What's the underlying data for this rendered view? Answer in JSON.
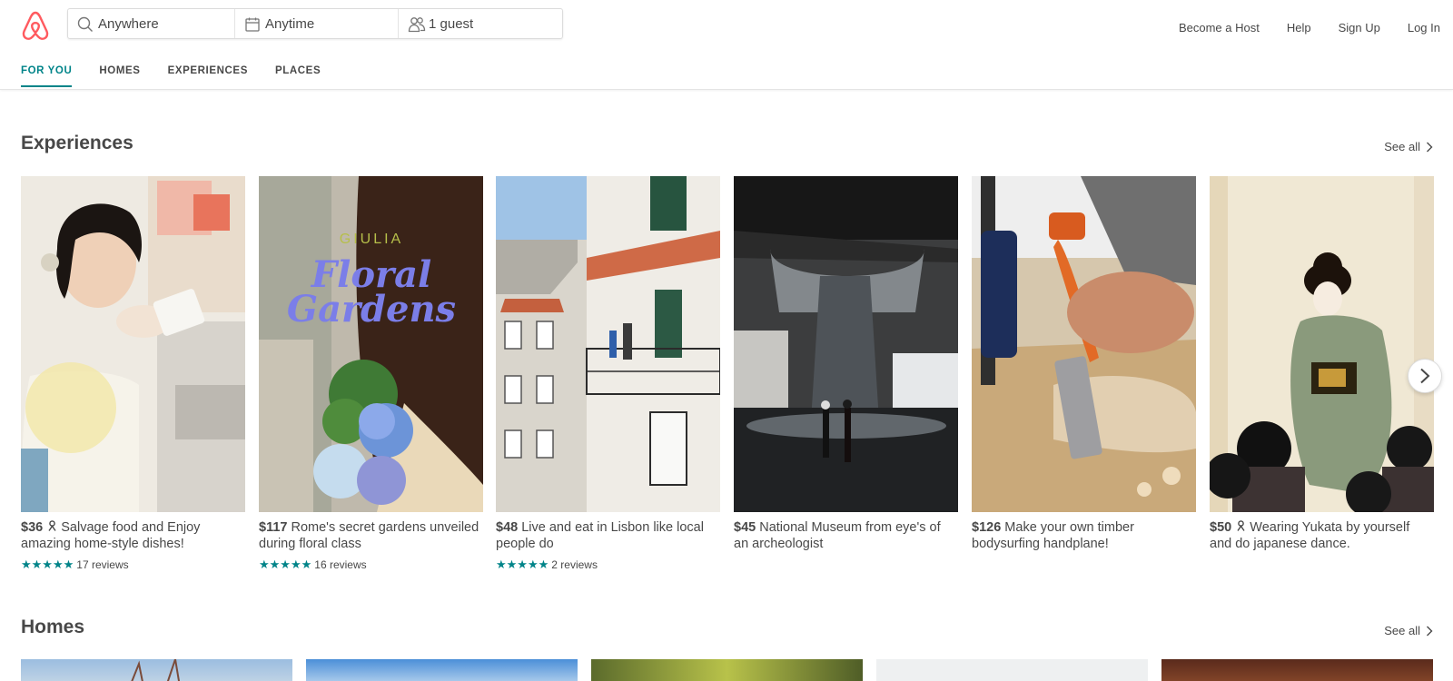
{
  "header": {
    "search": {
      "where_value": "Anywhere",
      "when_value": "Anytime",
      "guests_value": "1 guest"
    },
    "nav": [
      "Become a Host",
      "Help",
      "Sign Up",
      "Log In"
    ],
    "tabs": [
      {
        "label": "FOR YOU",
        "active": true
      },
      {
        "label": "HOMES",
        "active": false
      },
      {
        "label": "EXPERIENCES",
        "active": false
      },
      {
        "label": "PLACES",
        "active": false
      }
    ]
  },
  "colors": {
    "brand": "#FF5A5F",
    "accent": "#008489",
    "text": "#484848"
  },
  "experiences": {
    "title": "Experiences",
    "see_all": "See all",
    "cards": [
      {
        "price": "$36",
        "icon": "person-icon",
        "text": "Salvage food and Enjoy amazing home-style dishes!",
        "stars": 5,
        "reviews": "17 reviews"
      },
      {
        "price": "$117",
        "text": "Rome's secret gardens unveiled during floral class",
        "stars": 5,
        "reviews": "16 reviews",
        "overlay_name": "GIULIA",
        "overlay_title_1": "Floral",
        "overlay_title_2": "Gardens"
      },
      {
        "price": "$48",
        "text": "Live and eat in Lisbon like local people do",
        "stars": 5,
        "reviews": "2 reviews"
      },
      {
        "price": "$45",
        "text": "National Museum from eye's of an archeologist"
      },
      {
        "price": "$126",
        "text": "Make your own timber bodysurfing handplane!"
      },
      {
        "price": "$50",
        "icon": "person-icon",
        "text": "Wearing Yukata by yourself and do japanese dance."
      }
    ]
  },
  "homes": {
    "title": "Homes",
    "see_all": "See all"
  }
}
